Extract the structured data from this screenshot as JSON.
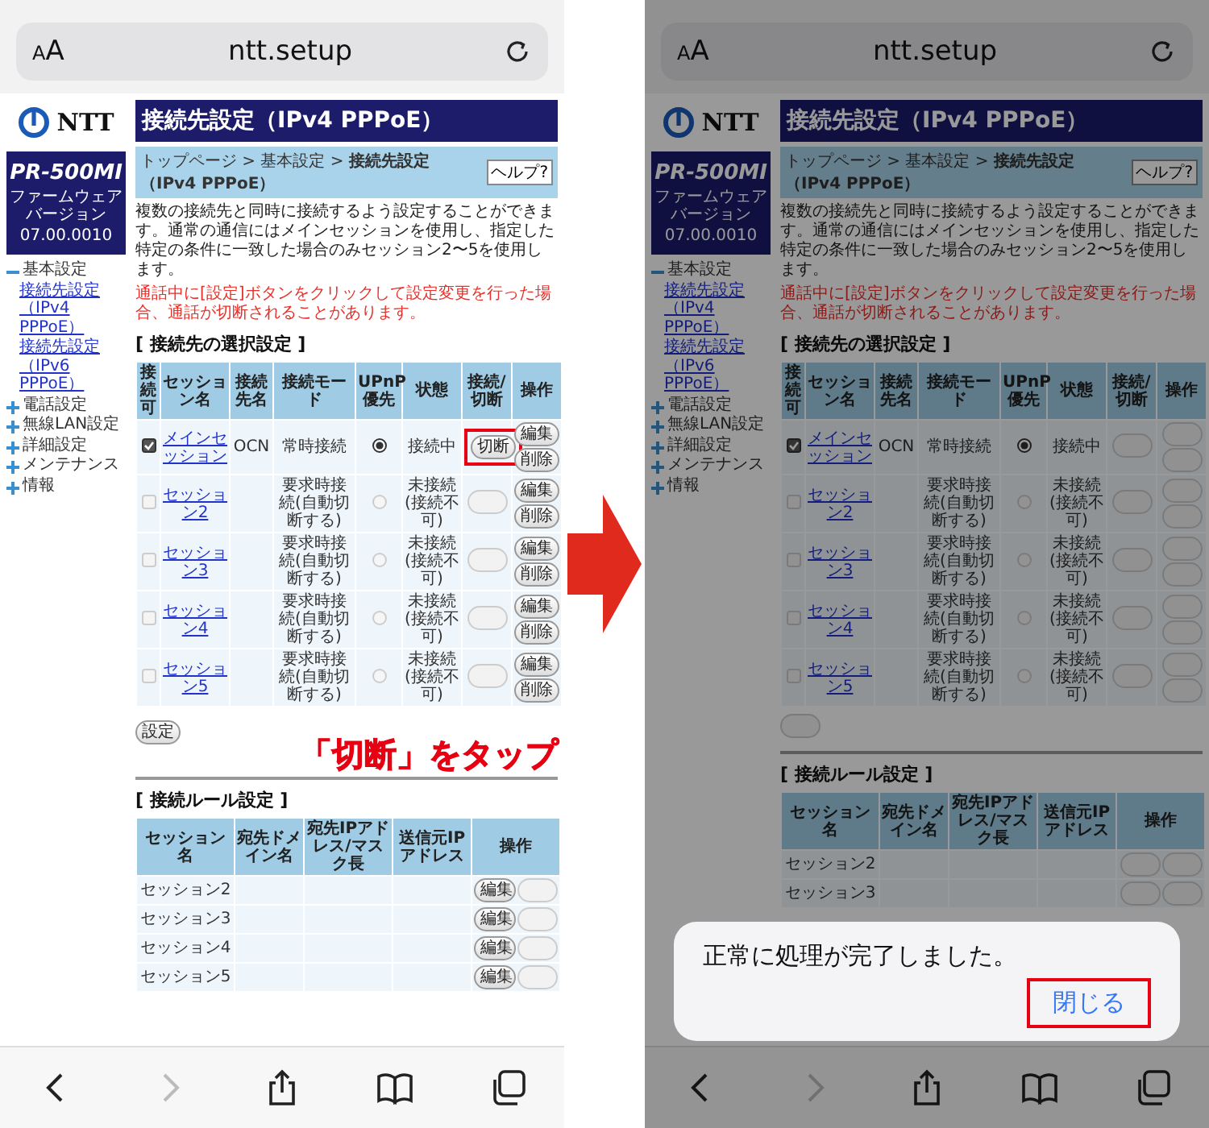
{
  "screens": [
    {
      "address_bar": {
        "text_size": "AA",
        "url": "ntt.setup"
      },
      "router_page": {
        "logo": "NTT",
        "model": "PR-500MI",
        "firmware_label": "ファームウェアバージョン",
        "firmware_version": "07.00.0010",
        "menu": [
          {
            "label": "基本設定",
            "expanded": true,
            "children": [
              {
                "label": "接続先設定（IPv4 PPPoE）"
              },
              {
                "label": "接続先設定（IPv6 PPPoE）"
              }
            ]
          },
          {
            "label": "電話設定",
            "expanded": false
          },
          {
            "label": "無線LAN設定",
            "expanded": false
          },
          {
            "label": "詳細設定",
            "expanded": false
          },
          {
            "label": "メンテナンス",
            "expanded": false
          },
          {
            "label": "情報",
            "expanded": false
          }
        ],
        "title": "接続先設定（IPv4 PPPoE）",
        "breadcrumb": "トップページ > 基本設定 > **接続先設定（IPv4 PPPoE）**",
        "help_button": "ヘルプ?",
        "description": "複数の接続先と同時に接続するよう設定することができます。通常の通信にはメインセッションを使用し、指定した特定の条件に一致した場合のみセッション2〜5を使用します。",
        "warning": "通話中に[設定]ボタンをクリックして設定変更を行った場合、通話が切断されることがあります。",
        "connection_section": {
          "heading": "[ 接続先の選択設定 ]",
          "columns": [
            "接続可",
            "セッション名",
            "接続先名",
            "接続モード",
            "UPnP優先",
            "状態",
            "接続/切断",
            "操作"
          ],
          "rows": [
            {
              "enabled": true,
              "name": "メインセッション",
              "destination": "OCN",
              "mode": "常時接続",
              "upnp_selected": true,
              "status": "接続中",
              "connect_button": {
                "label": "切断",
                "disabled": false,
                "highlighted": true
              },
              "edit_button": {
                "label": "編集",
                "disabled": false
              },
              "delete_button": {
                "label": "削除",
                "disabled": false
              }
            },
            {
              "enabled": false,
              "name": "セッション2",
              "mode": "要求時接続(自動切断する)",
              "upnp_selected": false,
              "status": "未接続(接続不可)",
              "connect_button": {
                "disabled": true,
                "highlighted": false
              },
              "edit_button": {
                "label": "編集",
                "disabled": false
              },
              "delete_button": {
                "label": "削除",
                "disabled": false
              }
            },
            {
              "enabled": false,
              "name": "セッション3",
              "mode": "要求時接続(自動切断する)",
              "upnp_selected": false,
              "status": "未接続(接続不可)",
              "connect_button": {
                "disabled": true,
                "highlighted": false
              },
              "edit_button": {
                "label": "編集",
                "disabled": false
              },
              "delete_button": {
                "label": "削除",
                "disabled": false
              }
            },
            {
              "enabled": false,
              "name": "セッション4",
              "mode": "要求時接続(自動切断する)",
              "upnp_selected": false,
              "status": "未接続(接続不可)",
              "connect_button": {
                "disabled": true,
                "highlighted": false
              },
              "edit_button": {
                "label": "編集",
                "disabled": false
              },
              "delete_button": {
                "label": "削除",
                "disabled": false
              }
            },
            {
              "enabled": false,
              "name": "セッション5",
              "mode": "要求時接続(自動切断する)",
              "upnp_selected": false,
              "status": "未接続(接続不可)",
              "connect_button": {
                "disabled": true,
                "highlighted": false
              },
              "edit_button": {
                "label": "編集",
                "disabled": false
              },
              "delete_button": {
                "label": "削除",
                "disabled": false
              }
            }
          ],
          "apply_button": {
            "label": "設定",
            "disabled": false
          }
        },
        "tap_label": "「切断」をタップ",
        "rule_section": {
          "heading": "[ 接続ルール設定 ]",
          "columns": [
            "セッション名",
            "宛先ドメイン名",
            "宛先IPアドレス/マスク長",
            "送信元IPアドレス",
            "操作"
          ],
          "rows": [
            {
              "name": "セッション2",
              "edit_button": {
                "label": "編集",
                "disabled": false
              },
              "delete_button": {
                "disabled": true
              }
            },
            {
              "name": "セッション3",
              "edit_button": {
                "label": "編集",
                "disabled": false
              },
              "delete_button": {
                "disabled": true
              }
            },
            {
              "name": "セッション4",
              "edit_button": {
                "label": "編集",
                "disabled": false
              },
              "delete_button": {
                "disabled": true
              }
            },
            {
              "name": "セッション5",
              "edit_button": {
                "label": "編集",
                "disabled": false
              },
              "delete_button": {
                "disabled": true
              }
            }
          ]
        }
      }
    },
    {
      "dimmed": true,
      "address_bar": {
        "text_size": "AA",
        "url": "ntt.setup"
      },
      "router_page": {
        "logo": "NTT",
        "model": "PR-500MI",
        "firmware_label": "ファームウェアバージョン",
        "firmware_version": "07.00.0010",
        "menu": [
          {
            "label": "基本設定",
            "expanded": true,
            "children": [
              {
                "label": "接続先設定（IPv4 PPPoE）"
              },
              {
                "label": "接続先設定（IPv6 PPPoE）"
              }
            ]
          },
          {
            "label": "電話設定",
            "expanded": false
          },
          {
            "label": "無線LAN設定",
            "expanded": false
          },
          {
            "label": "詳細設定",
            "expanded": false
          },
          {
            "label": "メンテナンス",
            "expanded": false
          },
          {
            "label": "情報",
            "expanded": false
          }
        ],
        "title": "接続先設定（IPv4 PPPoE）",
        "breadcrumb": "トップページ > 基本設定 > **接続先設定（IPv4 PPPoE）**",
        "help_button": "ヘルプ?",
        "description": "複数の接続先と同時に接続するよう設定することができます。通常の通信にはメインセッションを使用し、指定した特定の条件に一致した場合のみセッション2〜5を使用します。",
        "warning": "通話中に[設定]ボタンをクリックして設定変更を行った場合、通話が切断されることがあります。",
        "connection_section": {
          "heading": "[ 接続先の選択設定 ]",
          "columns": [
            "接続可",
            "セッション名",
            "接続先名",
            "接続モード",
            "UPnP優先",
            "状態",
            "接続/切断",
            "操作"
          ],
          "rows": [
            {
              "enabled": true,
              "name": "メインセッション",
              "destination": "OCN",
              "mode": "常時接続",
              "upnp_selected": true,
              "status": "接続中",
              "connect_button": {
                "disabled": true,
                "highlighted": false
              },
              "edit_button": {
                "disabled": true
              },
              "delete_button": {
                "disabled": true
              }
            },
            {
              "enabled": false,
              "name": "セッション2",
              "mode": "要求時接続(自動切断する)",
              "upnp_selected": false,
              "status": "未接続(接続不可)",
              "connect_button": {
                "disabled": true,
                "highlighted": false
              },
              "edit_button": {
                "disabled": true
              },
              "delete_button": {
                "disabled": true
              }
            },
            {
              "enabled": false,
              "name": "セッション3",
              "mode": "要求時接続(自動切断する)",
              "upnp_selected": false,
              "status": "未接続(接続不可)",
              "connect_button": {
                "disabled": true,
                "highlighted": false
              },
              "edit_button": {
                "disabled": true
              },
              "delete_button": {
                "disabled": true
              }
            },
            {
              "enabled": false,
              "name": "セッション4",
              "mode": "要求時接続(自動切断する)",
              "upnp_selected": false,
              "status": "未接続(接続不可)",
              "connect_button": {
                "disabled": true,
                "highlighted": false
              },
              "edit_button": {
                "disabled": true
              },
              "delete_button": {
                "disabled": true
              }
            },
            {
              "enabled": false,
              "name": "セッション5",
              "mode": "要求時接続(自動切断する)",
              "upnp_selected": false,
              "status": "未接続(接続不可)",
              "connect_button": {
                "disabled": true,
                "highlighted": false
              },
              "edit_button": {
                "disabled": true
              },
              "delete_button": {
                "disabled": true
              }
            }
          ],
          "apply_button": {
            "disabled": true
          }
        },
        "rule_section": {
          "heading": "[ 接続ルール設定 ]",
          "columns": [
            "セッション名",
            "宛先ドメイン名",
            "宛先IPアドレス/マスク長",
            "送信元IPアドレス",
            "操作"
          ],
          "rows": [
            {
              "name": "セッション2",
              "edit_button": {
                "disabled": true
              },
              "delete_button": {
                "disabled": true
              }
            },
            {
              "name": "セッション3",
              "edit_button": {
                "disabled": true
              },
              "delete_button": {
                "disabled": true
              }
            }
          ]
        }
      },
      "dialog": {
        "message": "正常に処理が完了しました。",
        "close_button": "閉じる",
        "close_highlighted": true
      }
    }
  ]
}
